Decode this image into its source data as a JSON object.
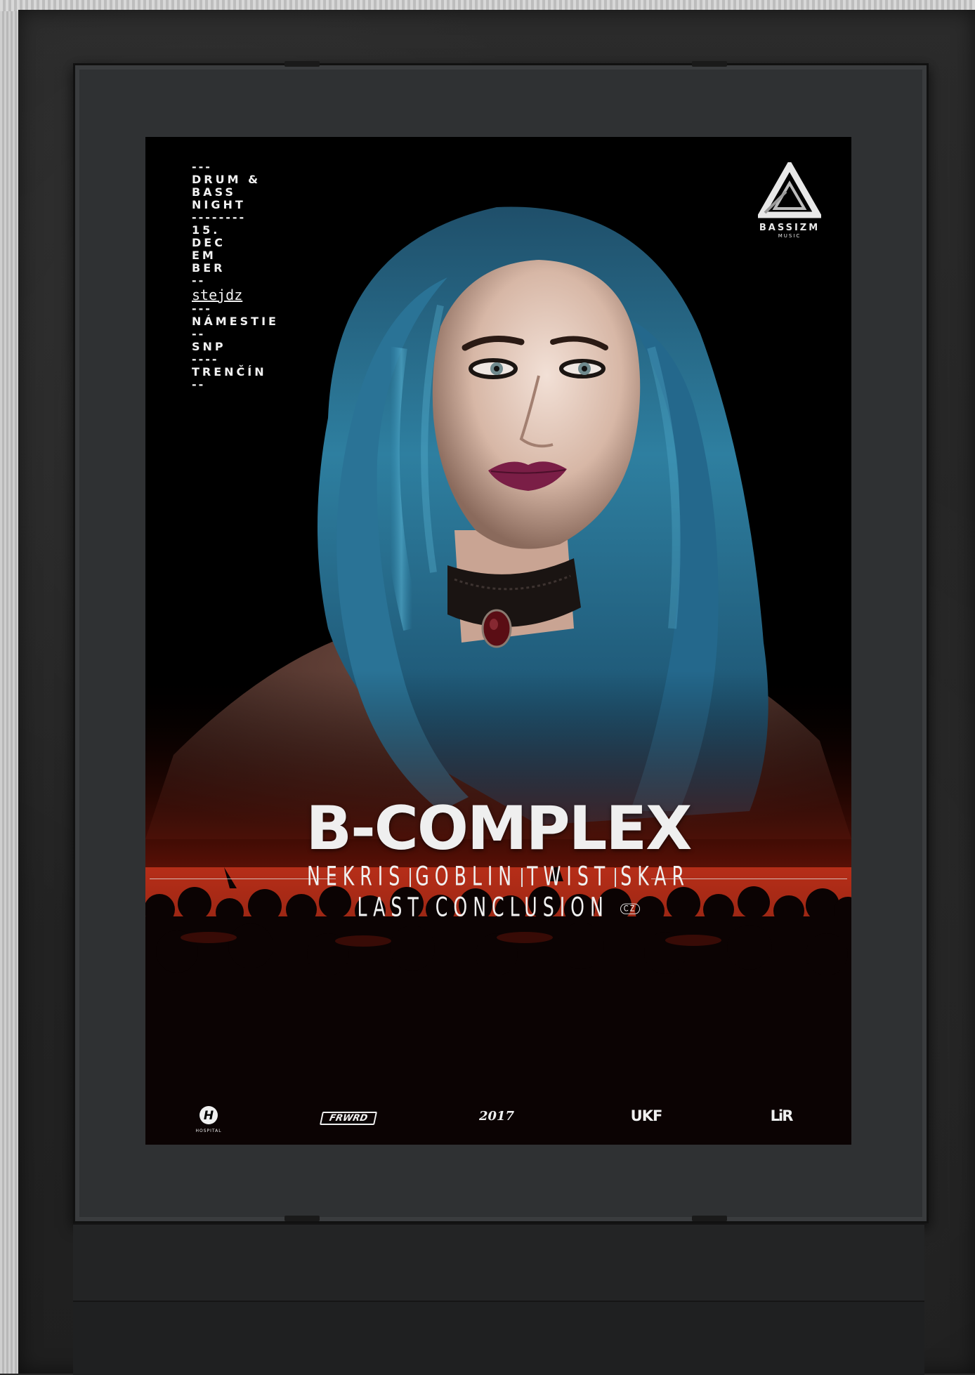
{
  "poster": {
    "info": {
      "lines": [
        "DRUM &",
        "BASS",
        "NIGHT",
        "15.",
        "DEC",
        "EM",
        "BER",
        "stejdz",
        "NÁMESTIE",
        "SNP",
        "TRENČÍN"
      ],
      "dashes": [
        "---",
        "--------",
        "--",
        "---",
        "--",
        "----",
        "--"
      ]
    },
    "brand": {
      "name": "BASSIZM",
      "sub": "MUSIC"
    },
    "headliner": "B-COMPLEX",
    "support_row1": [
      "NEKRIS",
      "GOBLIN",
      "TWIST",
      "SKAR"
    ],
    "support_row2": {
      "name": "LAST CONCLUSION",
      "tag": "CZ"
    },
    "sponsors": [
      "HOSPITAL",
      "FRWRD",
      "2017",
      "UKF",
      "LiR"
    ]
  }
}
